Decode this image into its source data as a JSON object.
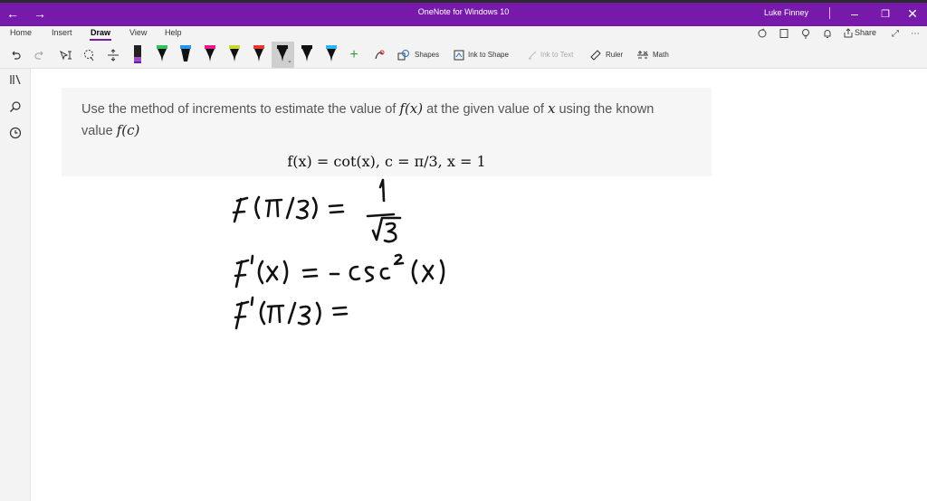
{
  "window": {
    "title": "OneNote for Windows 10",
    "user": "Luke Finney",
    "nav_back_icon": "arrow-left-icon",
    "nav_forward_icon": "arrow-right-icon",
    "controls": [
      "minimize-icon",
      "restore-icon",
      "close-icon"
    ],
    "accent": "#7719aa"
  },
  "menu": {
    "items": [
      "Home",
      "Insert",
      "Draw",
      "View",
      "Help"
    ],
    "active": "Draw",
    "share_label": "Share"
  },
  "toolbar": {
    "pens": [
      {
        "color": "#000000"
      },
      {
        "color": "#7a3b9b"
      },
      {
        "color": "#32a852"
      },
      {
        "color": "#2196f3"
      },
      {
        "color": "#e91e8c"
      },
      {
        "color": "#c8d82f"
      },
      {
        "color": "#e53935"
      },
      {
        "color": "#111111"
      },
      {
        "color": "#000000"
      },
      {
        "color": "#29b6f6"
      }
    ],
    "shapes_label": "Shapes",
    "ink_to_shape_label": "Ink to Shape",
    "ink_to_text_label": "Ink to Text",
    "ruler_label": "Ruler",
    "math_label": "Math"
  },
  "question": {
    "line1_pre": "Use the method of increments to estimate the value of ",
    "line1_fx": "f(x)",
    "line1_mid": " at the given value of ",
    "line1_x": "x",
    "line1_post": " using the known",
    "line2_pre": "value ",
    "line2_fc": "f(c)",
    "equation": "f(x) = cot(x), c = π/3, x = 1"
  },
  "notes": {
    "line1": "f(π/3) = 1/√3",
    "line2": "f'(x) = - csc²(x)",
    "line3": "f'(π/3) ="
  }
}
